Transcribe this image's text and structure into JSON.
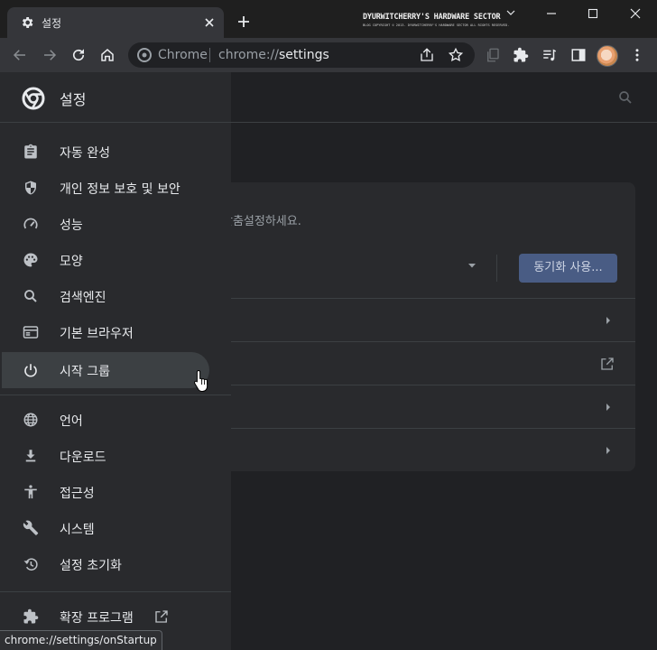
{
  "tab": {
    "title": "설정"
  },
  "banner": {
    "title": "DYURWITCHERRY'S HARDWARE SECTOR",
    "subtitle": "BLOG COPYRIGHT © 2013. DYURWITCHERRY'S HARDWARE SECTOR ALL RIGHTS RESERVED."
  },
  "omnibox": {
    "chip": "Chrome",
    "url_prefix": "chrome://",
    "url_host": "settings"
  },
  "drawer": {
    "title": "설정",
    "items": [
      {
        "label": "자동 완성",
        "icon": "clipboard-icon"
      },
      {
        "label": "개인 정보 보호 및 보안",
        "icon": "shield-icon"
      },
      {
        "label": "성능",
        "icon": "speedometer-icon"
      },
      {
        "label": "모양",
        "icon": "palette-icon"
      },
      {
        "label": "검색엔진",
        "icon": "search-icon"
      },
      {
        "label": "기본 브라우저",
        "icon": "browser-icon"
      },
      {
        "label": "시작 그룹",
        "icon": "power-icon",
        "selected": true
      },
      {
        "label": "언어",
        "icon": "globe-icon"
      },
      {
        "label": "다운로드",
        "icon": "download-icon"
      },
      {
        "label": "접근성",
        "icon": "accessibility-icon"
      },
      {
        "label": "시스템",
        "icon": "wrench-icon"
      },
      {
        "label": "설정 초기화",
        "icon": "restore-icon"
      },
      {
        "label": "확장 프로그램",
        "icon": "puzzle-icon"
      }
    ]
  },
  "main": {
    "description": "맞춤설정하세요.",
    "sync_button": "동기화 사용..."
  },
  "status_bar": "chrome://settings/onStartup",
  "colors": {
    "accent_button": "#495c84",
    "selected_item": "#3c4043",
    "drawer_bg": "#292a2d",
    "page_bg": "#202124"
  }
}
